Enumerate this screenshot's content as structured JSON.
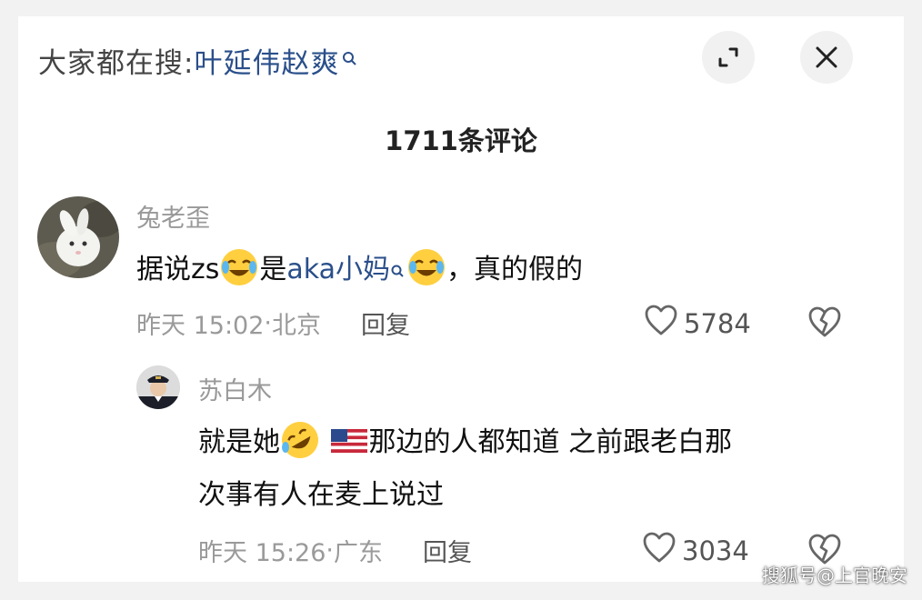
{
  "search": {
    "prefix": "大家都在搜:",
    "term": "叶延伟赵爽"
  },
  "comments_header": {
    "title": "1711条评论"
  },
  "comments": [
    {
      "username": "兔老歪",
      "text_part1": "据说zs",
      "text_link": "aka小妈",
      "text_mid": "是",
      "text_part2": "，真的假的",
      "time": "昨天 15:02",
      "location": "北京",
      "reply_label": "回复",
      "likes": "5784",
      "avatar_icon": "rabbit-avatar"
    },
    {
      "username": "苏白木",
      "text_line1_a": "就是她",
      "text_line1_b": "那边的人都知道 之前跟老白那",
      "text_line2": "次事有人在麦上说过",
      "time": "昨天 15:26",
      "location": "广东",
      "reply_label": "回复",
      "likes": "3034",
      "avatar_icon": "pilot-avatar"
    }
  ],
  "watermark": "搜狐号@上官晚安",
  "colors": {
    "link": "#2a4f8a",
    "muted": "#9a9a9a",
    "text": "#111111"
  }
}
